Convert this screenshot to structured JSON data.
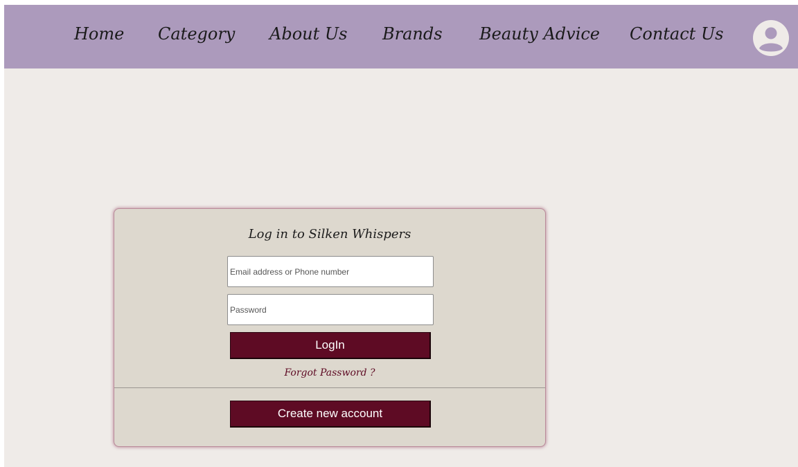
{
  "nav": {
    "items": [
      {
        "label": "Home"
      },
      {
        "label": "Category"
      },
      {
        "label": "About Us"
      },
      {
        "label": "Brands"
      },
      {
        "label": "Beauty Advice"
      },
      {
        "label": "Contact Us"
      }
    ],
    "profile_icon": "user-circle-icon"
  },
  "login": {
    "title": "Log in to Silken Whispers",
    "email_placeholder": "Email address or Phone number",
    "password_placeholder": "Password",
    "login_label": "LogIn",
    "forgot_label": "Forgot Password ?",
    "create_label": "Create new account"
  },
  "colors": {
    "navbar": "#ac9abc",
    "background": "#efebe8",
    "card": "#ddd8ce",
    "button": "#5e0b24"
  }
}
